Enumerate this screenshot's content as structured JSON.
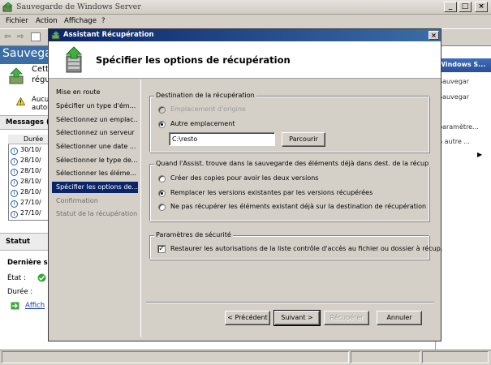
{
  "main_window": {
    "title": "Sauvegarde de Windows Server",
    "menu": [
      "Fichier",
      "Action",
      "Affichage",
      "?"
    ],
    "panel_title_partial": "Sauvegar",
    "heading_partial": [
      "Cett",
      "régu"
    ],
    "notice_partial": [
      "Aucu",
      "autor"
    ],
    "messages_label_partial": "Messages (",
    "messages_column": "Durée",
    "message_rows": [
      "30/10/",
      "28/10/",
      "28/10/",
      "28/10/",
      "28/10/",
      "27/10/",
      "27/10/"
    ],
    "status_title": "Statut",
    "last_backup_partial": "Dernière sa",
    "state_label": "État :",
    "duration_label": "Durée :",
    "show_link_partial": "Affich",
    "actions_header_partial": "Windows S...",
    "actions": [
      "Sauvegar",
      "Sauvegar",
      "paramètre...",
      "n autre ..."
    ]
  },
  "wizard": {
    "title": "Assistant Récupération",
    "heading": "Spécifier les options de récupération",
    "steps": [
      {
        "label": "Mise en route",
        "state": "done"
      },
      {
        "label": "Spécifier un type d'ém...",
        "state": "done"
      },
      {
        "label": "Sélectionnez un emplac...",
        "state": "done"
      },
      {
        "label": "Sélectionnez un serveur",
        "state": "done"
      },
      {
        "label": "Sélectionner une date ...",
        "state": "done"
      },
      {
        "label": "Sélectionner le type de...",
        "state": "done"
      },
      {
        "label": "Sélectionner les éléme...",
        "state": "done"
      },
      {
        "label": "Spécifier les options de...",
        "state": "current"
      },
      {
        "label": "Confirmation",
        "state": "todo"
      },
      {
        "label": "Statut de la récupération",
        "state": "todo"
      }
    ],
    "destination": {
      "group_label": "Destination de la récupération",
      "option_original": "Emplacement d'origine",
      "option_other": "Autre emplacement",
      "path_value": "C:\\resto",
      "browse_button": "Parcourir"
    },
    "conflict": {
      "group_label": "Quand l'Assist. trouve dans la sauvegarde des éléments déjà dans dest. de la récup",
      "option_copies": "Créer des copies pour avoir les deux versions",
      "option_replace": "Remplacer les versions existantes par les versions récupérées",
      "option_skip": "Ne pas récupérer les éléments existant déjà sur la destination de récupération"
    },
    "security": {
      "group_label": "Paramètres de sécurité",
      "restore_acl": "Restaurer les autorisations de la liste contrôle d'accès au fichier ou dossier à récup."
    },
    "buttons": {
      "previous": "< Précédent",
      "next": "Suivant >",
      "recover": "Récupérer",
      "cancel": "Annuler"
    }
  },
  "colors": {
    "title_bar": "#0a246a",
    "selected_step": "#0a246a",
    "face": "#d4d0c8"
  }
}
